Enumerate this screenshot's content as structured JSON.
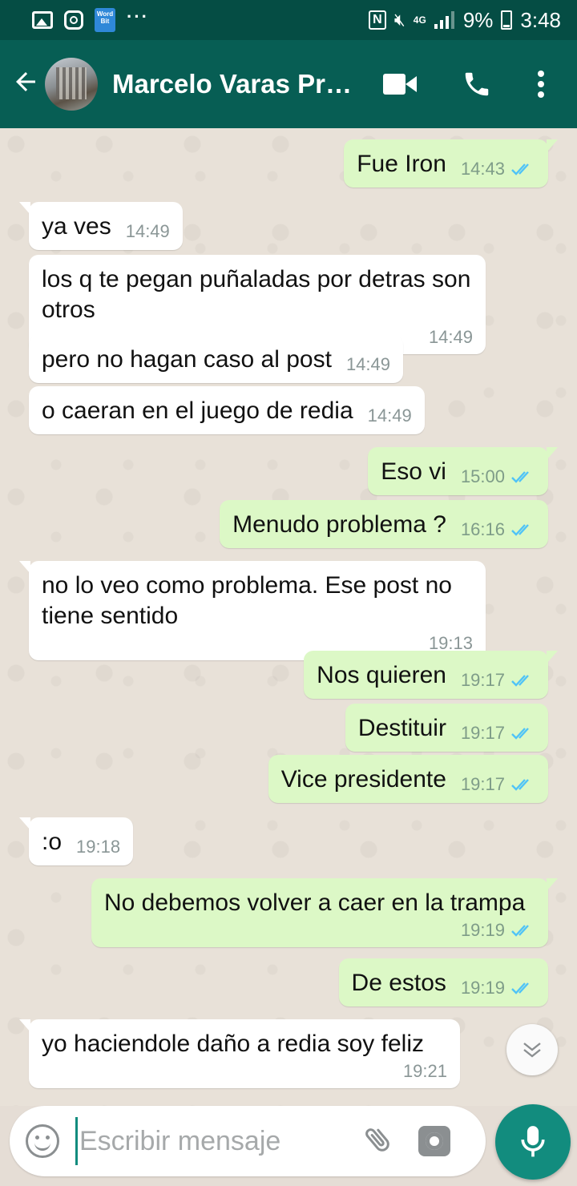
{
  "status_bar": {
    "network": "4G",
    "battery": "9%",
    "time": "3:48",
    "wordbit_label": "Word Bit"
  },
  "header": {
    "contact_name": "Marcelo Varas Pr…"
  },
  "colors": {
    "header": "#075e54",
    "status_bar": "#054d44",
    "outgoing_bubble": "#dcf8c6",
    "incoming_bubble": "#ffffff",
    "read_ticks": "#4fc3f7",
    "accent": "#128c7e"
  },
  "messages": [
    {
      "dir": "out",
      "text": "Fue Iron",
      "time": "14:43"
    },
    {
      "dir": "in",
      "text": "ya ves",
      "time": "14:49"
    },
    {
      "dir": "in",
      "text": "los q te pegan puñaladas por detras son otros",
      "time": "14:49"
    },
    {
      "dir": "in",
      "text": "pero no hagan caso al post",
      "time": "14:49"
    },
    {
      "dir": "in",
      "text": "o caeran en el juego de redia",
      "time": "14:49"
    },
    {
      "dir": "out",
      "text": "Eso vi",
      "time": "15:00"
    },
    {
      "dir": "out",
      "text": "Menudo problema ?",
      "time": "16:16"
    },
    {
      "dir": "in",
      "text": "no lo veo como problema. Ese post no tiene sentido",
      "time": "19:13"
    },
    {
      "dir": "out",
      "text": "Nos quieren",
      "time": "19:17"
    },
    {
      "dir": "out",
      "text": "Destituir",
      "time": "19:17"
    },
    {
      "dir": "out",
      "text": "Vice presidente",
      "time": "19:17"
    },
    {
      "dir": "in",
      "text": ":o",
      "time": "19:18"
    },
    {
      "dir": "out",
      "text": "No debemos volver a caer en la trampa",
      "time": "19:19"
    },
    {
      "dir": "out",
      "text": "De estos",
      "time": "19:19"
    },
    {
      "dir": "in",
      "text": "yo haciendole daño a redia soy feliz",
      "time": "19:21"
    }
  ],
  "input": {
    "placeholder": "Escribir mensaje",
    "value": ""
  },
  "icons": {
    "back": "arrow-left-icon",
    "video": "video-call-icon",
    "call": "phone-icon",
    "menu": "more-vert-icon",
    "emoji": "emoji-icon",
    "attach": "paperclip-icon",
    "camera": "camera-icon",
    "mic": "mic-icon",
    "scroll": "double-chevron-down-icon"
  }
}
